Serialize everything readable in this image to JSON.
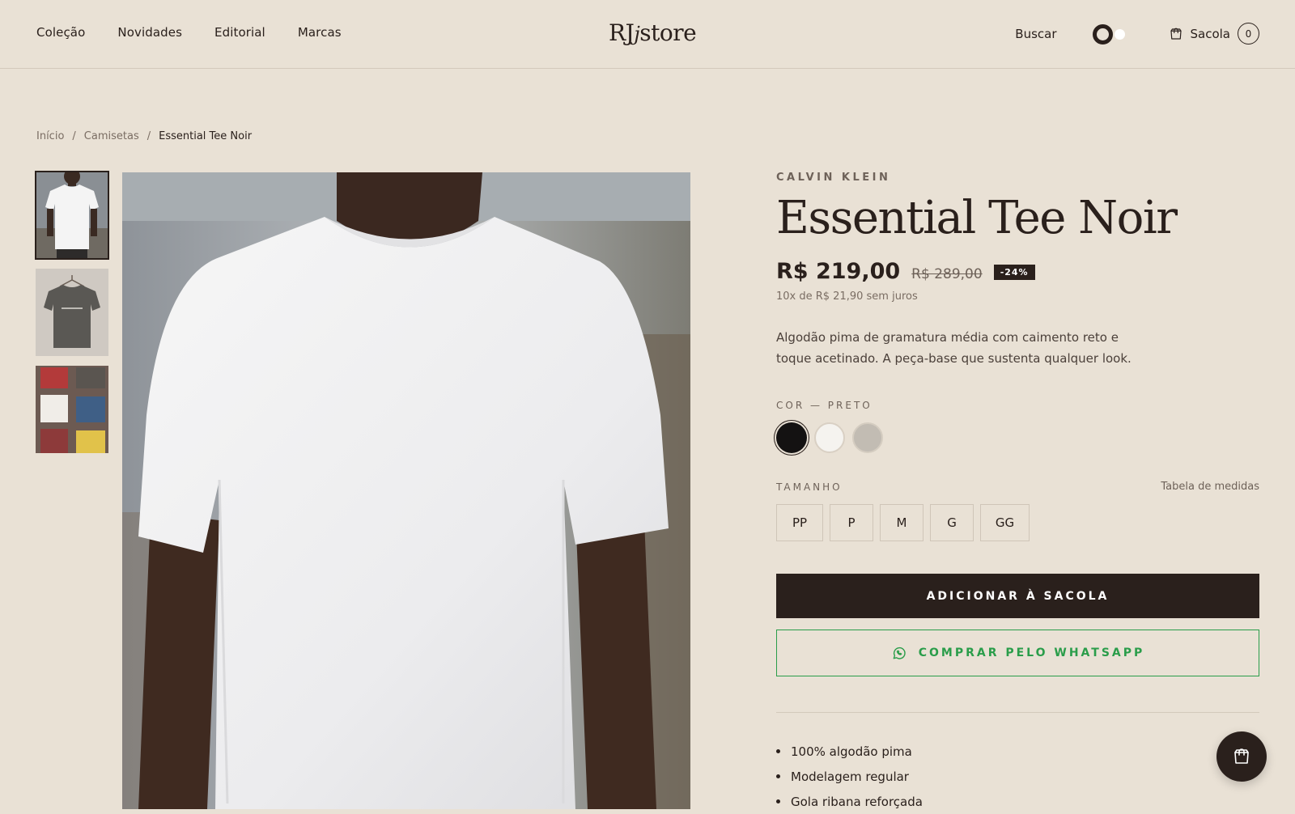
{
  "nav": {
    "items": [
      "Coleção",
      "Novidades",
      "Editorial",
      "Marcas"
    ]
  },
  "logo": {
    "main": "RJ",
    "accent": "j",
    "rest": "store"
  },
  "header": {
    "search_label": "Buscar",
    "bag_label": "Sacola",
    "bag_count": "0"
  },
  "breadcrumb": {
    "items": [
      "Início",
      "Camisetas"
    ],
    "current": "Essential Tee Noir",
    "separator": "/"
  },
  "gallery": {
    "thumbnails": [
      "front-white-tee",
      "dark-tee-on-hanger",
      "folded-tees-grid"
    ],
    "active_index": 0,
    "main_image": "white-tee-model"
  },
  "product": {
    "brand": "CALVIN KLEIN",
    "title": "Essential Tee Noir",
    "price": "R$ 219,00",
    "old_price": "R$ 289,00",
    "discount": "-24%",
    "installments": "10x de R$ 21,90 sem juros",
    "description": "Algodão pima de gramatura média com caimento reto e toque acetinado. A peça-base que sustenta qualquer look.",
    "color_label": "COR — PRETO",
    "colors": [
      {
        "name": "black",
        "hex": "#141212"
      },
      {
        "name": "white",
        "hex": "#f5f3ef"
      },
      {
        "name": "gray",
        "hex": "#c2bcb3"
      }
    ],
    "size_label": "TAMANHO",
    "size_guide": "Tabela de medidas",
    "sizes": [
      "PP",
      "P",
      "M",
      "G",
      "GG"
    ],
    "add_to_bag": "ADICIONAR À SACOLA",
    "buy_whatsapp": "COMPRAR PELO WHATSAPP",
    "features": [
      "100% algodão pima",
      "Modelagem regular",
      "Gola ribana reforçada"
    ]
  },
  "colors": {
    "accent": "#2a201c",
    "background": "#e9e1d5",
    "whatsapp": "#2a9d4a"
  }
}
